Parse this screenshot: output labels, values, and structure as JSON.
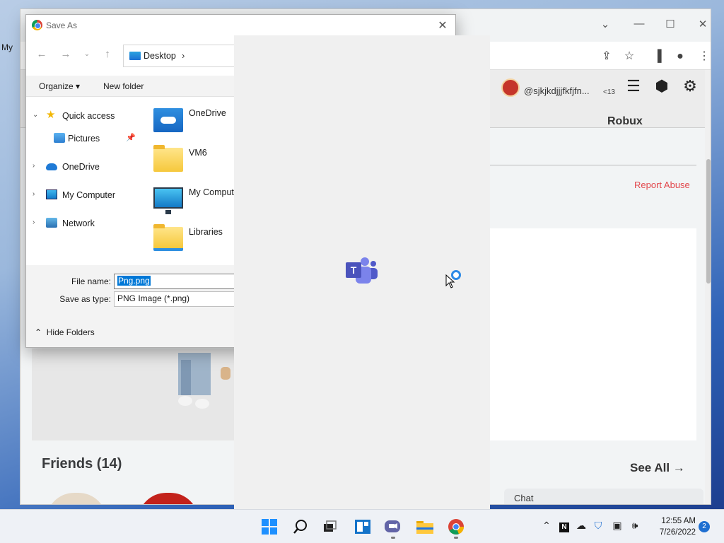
{
  "desktop": {
    "label": "My"
  },
  "browser": {
    "window_controls": [
      "⌄",
      "—",
      "☐",
      "✕"
    ],
    "header": {
      "username": "@sjkjkdjjjfkfjfn...",
      "age_badge": "<13",
      "currency": "Robux"
    },
    "report_abuse": "Report Abuse",
    "friends_title": "Friends (14)",
    "see_all": "See All →",
    "chat": "Chat"
  },
  "dialog": {
    "title": "Save As",
    "address": {
      "location": "Desktop"
    },
    "commands": {
      "organize": "Organize ▾",
      "new_folder": "New folder"
    },
    "nav_tree": [
      {
        "label": "Quick access",
        "icon": "star-icon"
      },
      {
        "label": "Pictures",
        "icon": "pictures-icon"
      },
      {
        "label": "OneDrive",
        "icon": "cloud-icon"
      },
      {
        "label": "My Computer",
        "icon": "computer-icon"
      },
      {
        "label": "Network",
        "icon": "network-icon"
      }
    ],
    "files": [
      {
        "name": "OneDrive",
        "icon": "onedrive-folder-icon"
      },
      {
        "name": "VM6",
        "icon": "folder-icon"
      },
      {
        "name": "My Comput",
        "icon": "computer-icon"
      },
      {
        "name": "Libraries",
        "icon": "library-folder-icon"
      }
    ],
    "file_name_label": "File name:",
    "file_name_value": "Png.png",
    "save_type_label": "Save as type:",
    "save_type_value": "PNG Image (*.png)",
    "hide_folders": "Hide Folders"
  },
  "taskbar": {
    "apps": [
      "start-icon",
      "search-icon",
      "task-view-icon",
      "widgets-icon",
      "teams-chat-icon",
      "file-explorer-icon",
      "chrome-icon"
    ],
    "time": "12:55 AM",
    "date": "7/26/2022",
    "notifications": "2"
  }
}
